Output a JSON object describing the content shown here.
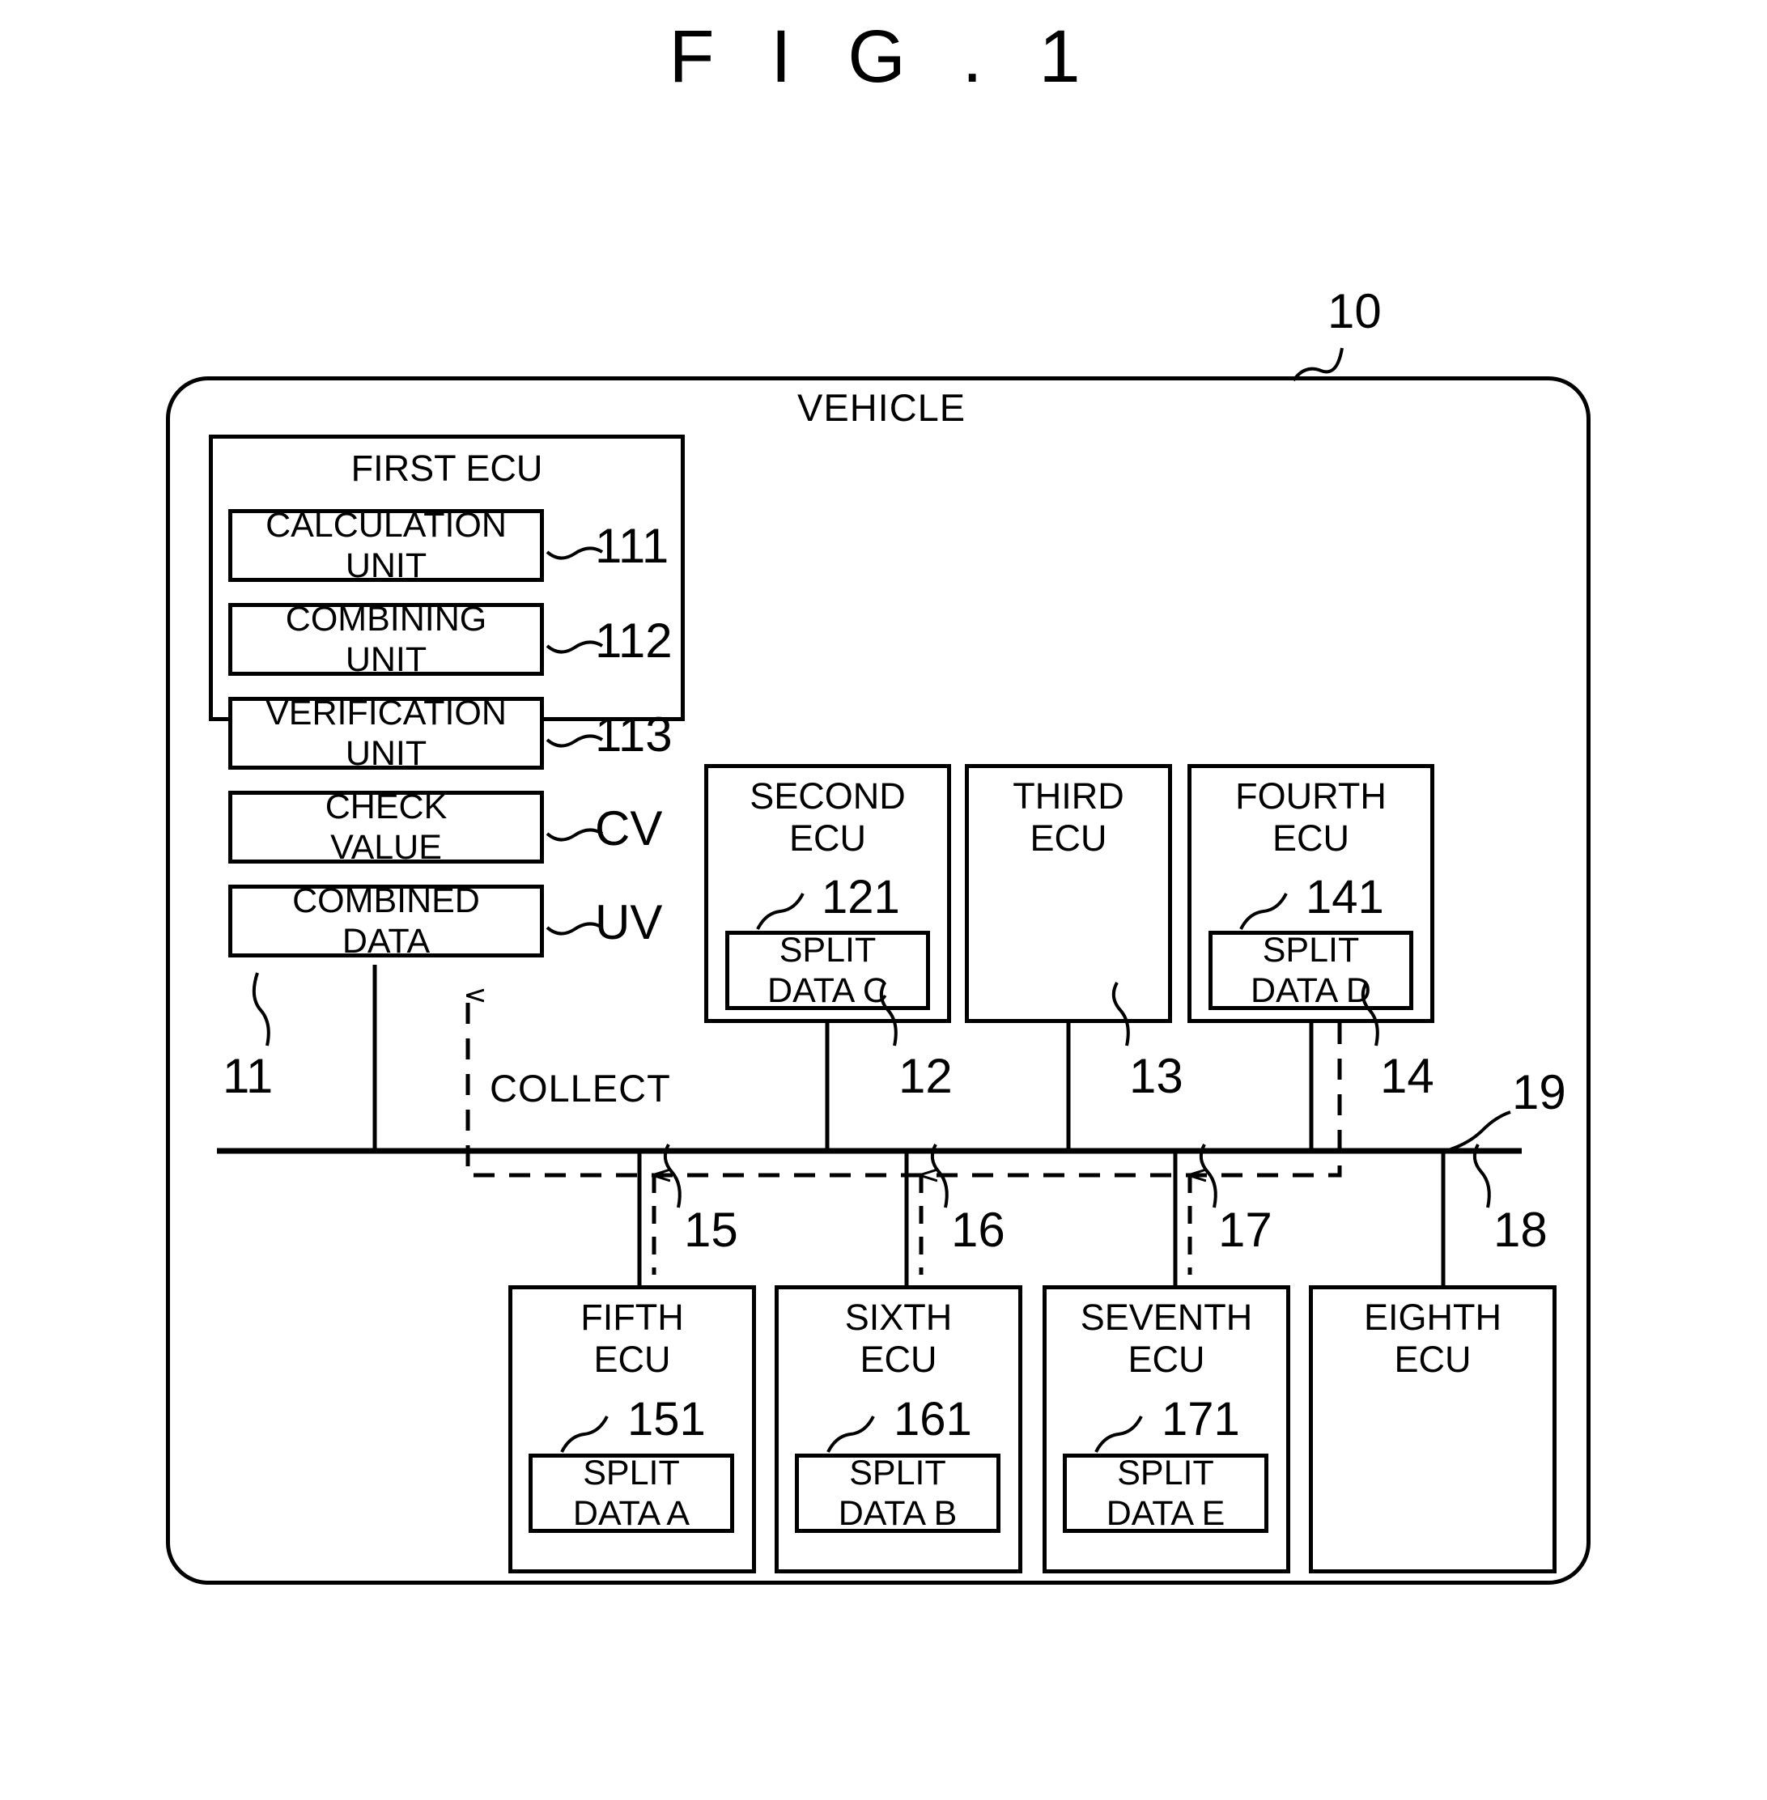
{
  "figure": {
    "title": "F I G . 1"
  },
  "vehicle": {
    "label": "VEHICLE",
    "ref": "10"
  },
  "bus": {
    "ref": "19",
    "collect_label": "COLLECT"
  },
  "first_ecu": {
    "title": "FIRST ECU",
    "ref": "11",
    "units": [
      {
        "label": "CALCULATION UNIT",
        "line1": "CALCULATION",
        "line2": "UNIT",
        "ref": "111"
      },
      {
        "label": "COMBINING UNIT",
        "line1": "COMBINING",
        "line2": "UNIT",
        "ref": "112"
      },
      {
        "label": "VERIFICATION UNIT",
        "line1": "VERIFICATION",
        "line2": "UNIT",
        "ref": "113"
      },
      {
        "label": "CHECK VALUE",
        "line1": "CHECK",
        "line2": "VALUE",
        "ref": "CV"
      },
      {
        "label": "COMBINED DATA",
        "line1": "COMBINED",
        "line2": "DATA",
        "ref": "UV"
      }
    ]
  },
  "ecus": [
    {
      "name": "SECOND ECU",
      "line1": "SECOND",
      "line2": "ECU",
      "ref": "12",
      "data_ref": "121",
      "data_line1": "SPLIT",
      "data_line2": "DATA C",
      "has_data": true
    },
    {
      "name": "THIRD ECU",
      "line1": "THIRD",
      "line2": "ECU",
      "ref": "13",
      "data_ref": "",
      "data_line1": "",
      "data_line2": "",
      "has_data": false
    },
    {
      "name": "FOURTH ECU",
      "line1": "FOURTH",
      "line2": "ECU",
      "ref": "14",
      "data_ref": "141",
      "data_line1": "SPLIT",
      "data_line2": "DATA D",
      "has_data": true
    },
    {
      "name": "FIFTH ECU",
      "line1": "FIFTH",
      "line2": "ECU",
      "ref": "15",
      "data_ref": "151",
      "data_line1": "SPLIT",
      "data_line2": "DATA A",
      "has_data": true
    },
    {
      "name": "SIXTH ECU",
      "line1": "SIXTH",
      "line2": "ECU",
      "ref": "16",
      "data_ref": "161",
      "data_line1": "SPLIT",
      "data_line2": "DATA B",
      "has_data": true
    },
    {
      "name": "SEVENTH ECU",
      "line1": "SEVENTH",
      "line2": "ECU",
      "ref": "17",
      "data_ref": "171",
      "data_line1": "SPLIT",
      "data_line2": "DATA E",
      "has_data": true
    },
    {
      "name": "EIGHTH ECU",
      "line1": "EIGHTH",
      "line2": "ECU",
      "ref": "18",
      "data_ref": "",
      "data_line1": "",
      "data_line2": "",
      "has_data": false
    }
  ]
}
